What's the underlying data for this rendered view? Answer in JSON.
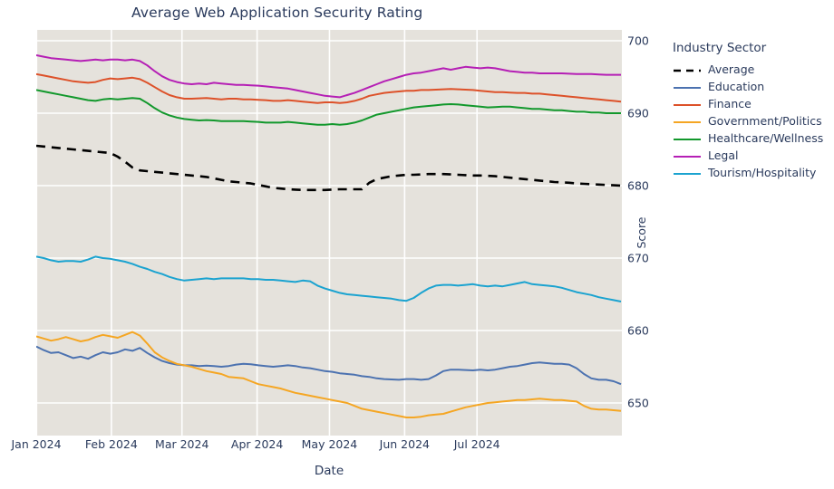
{
  "chart_data": {
    "type": "line",
    "title": "Average Web Application Security Rating",
    "xlabel": "Date",
    "ylabel": "Score",
    "grid": true,
    "legend_position": "right",
    "legend_title": "Industry Sector",
    "yaxis_side": "right",
    "ylim": [
      645.5,
      701.5
    ],
    "yticks": [
      650,
      660,
      670,
      680,
      690,
      700
    ],
    "ytick_labels": [
      "650",
      "660",
      "670",
      "680",
      "690",
      "700"
    ],
    "xlim": [
      "2024-01-01",
      "2024-07-20"
    ],
    "xticks": [
      "2024-01-01",
      "2024-02-01",
      "2024-03-01",
      "2024-04-01",
      "2024-05-01",
      "2024-06-01",
      "2024-07-01"
    ],
    "xtick_labels": [
      "Jan 2024",
      "Feb 2024",
      "Mar 2024",
      "Apr 2024",
      "May 2024",
      "Jun 2024",
      "Jul 2024"
    ],
    "x": [
      0,
      1,
      2,
      3,
      4,
      5,
      6,
      7,
      8,
      9,
      10,
      11,
      12,
      13,
      14,
      15,
      16,
      17,
      18,
      19,
      20,
      21,
      22,
      23,
      24,
      25,
      26,
      27,
      28,
      29,
      30,
      31,
      32,
      33,
      34,
      35,
      36,
      37,
      38,
      39,
      40,
      41,
      42,
      43,
      44,
      45,
      46,
      47,
      48,
      49,
      50,
      51,
      52,
      53,
      54,
      55,
      56,
      57,
      58,
      59,
      60,
      61,
      62,
      63,
      64,
      65,
      66,
      67,
      68,
      69,
      70,
      71,
      72,
      73,
      74,
      75,
      76,
      77,
      78,
      79
    ],
    "series": [
      {
        "name": "Average",
        "color": "#000000",
        "style": "dashed",
        "values": [
          685.5,
          685.4,
          685.3,
          685.2,
          685.1,
          685.0,
          684.9,
          684.8,
          684.7,
          684.6,
          684.5,
          684.0,
          683.3,
          682.5,
          682.1,
          682.0,
          681.9,
          681.8,
          681.7,
          681.6,
          681.5,
          681.4,
          681.3,
          681.2,
          681.0,
          680.8,
          680.6,
          680.5,
          680.4,
          680.3,
          680.1,
          679.9,
          679.7,
          679.6,
          679.5,
          679.45,
          679.4,
          679.4,
          679.4,
          679.4,
          679.45,
          679.5,
          679.5,
          679.5,
          679.5,
          680.4,
          680.9,
          681.1,
          681.3,
          681.4,
          681.5,
          681.5,
          681.55,
          681.6,
          681.6,
          681.6,
          681.55,
          681.5,
          681.45,
          681.4,
          681.4,
          681.35,
          681.3,
          681.2,
          681.1,
          681.0,
          680.9,
          680.8,
          680.7,
          680.6,
          680.5,
          680.45,
          680.4,
          680.3,
          680.25,
          680.2,
          680.15,
          680.1,
          680.05,
          680.0
        ]
      },
      {
        "name": "Education",
        "color": "#4c72b0",
        "style": "solid",
        "values": [
          657.8,
          657.3,
          656.9,
          657.0,
          656.6,
          656.2,
          656.4,
          656.1,
          656.6,
          657.0,
          656.8,
          657.0,
          657.4,
          657.2,
          657.6,
          656.9,
          656.3,
          655.8,
          655.5,
          655.3,
          655.2,
          655.2,
          655.1,
          655.15,
          655.1,
          655.0,
          655.1,
          655.3,
          655.4,
          655.35,
          655.2,
          655.1,
          655.0,
          655.1,
          655.2,
          655.1,
          654.9,
          654.8,
          654.6,
          654.4,
          654.3,
          654.1,
          654.0,
          653.9,
          653.7,
          653.6,
          653.4,
          653.3,
          653.25,
          653.2,
          653.3,
          653.3,
          653.2,
          653.3,
          653.8,
          654.4,
          654.6,
          654.6,
          654.55,
          654.5,
          654.6,
          654.5,
          654.6,
          654.8,
          655.0,
          655.1,
          655.3,
          655.5,
          655.6,
          655.5,
          655.4,
          655.4,
          655.3,
          654.8,
          654.0,
          653.4,
          653.2,
          653.2,
          653.0,
          652.6
        ]
      },
      {
        "name": "Finance",
        "color": "#dd5129",
        "style": "solid",
        "values": [
          695.4,
          695.2,
          695.0,
          694.8,
          694.6,
          694.4,
          694.3,
          694.2,
          694.3,
          694.6,
          694.8,
          694.7,
          694.8,
          694.9,
          694.7,
          694.2,
          693.6,
          693.0,
          692.5,
          692.2,
          692.0,
          692.0,
          692.05,
          692.1,
          692.0,
          691.9,
          692.0,
          692.0,
          691.9,
          691.9,
          691.85,
          691.8,
          691.7,
          691.7,
          691.8,
          691.7,
          691.6,
          691.5,
          691.4,
          691.5,
          691.5,
          691.4,
          691.5,
          691.7,
          692.0,
          692.4,
          692.6,
          692.8,
          692.9,
          693.0,
          693.1,
          693.1,
          693.2,
          693.2,
          693.25,
          693.3,
          693.35,
          693.3,
          693.25,
          693.2,
          693.1,
          693.0,
          692.9,
          692.9,
          692.85,
          692.8,
          692.8,
          692.7,
          692.7,
          692.6,
          692.5,
          692.4,
          692.3,
          692.2,
          692.1,
          692.0,
          691.9,
          691.8,
          691.7,
          691.6
        ]
      },
      {
        "name": "Government/Politics",
        "color": "#f5a623",
        "style": "solid",
        "values": [
          659.2,
          658.9,
          658.6,
          658.8,
          659.1,
          658.8,
          658.5,
          658.7,
          659.1,
          659.4,
          659.2,
          659.0,
          659.4,
          659.8,
          659.3,
          658.2,
          657.0,
          656.3,
          655.8,
          655.4,
          655.2,
          655.0,
          654.7,
          654.4,
          654.2,
          654.0,
          653.6,
          653.5,
          653.4,
          653.0,
          652.6,
          652.4,
          652.2,
          652.0,
          651.7,
          651.4,
          651.2,
          651.0,
          650.8,
          650.6,
          650.4,
          650.2,
          650.0,
          649.6,
          649.2,
          649.0,
          648.8,
          648.6,
          648.4,
          648.2,
          648.0,
          648.0,
          648.1,
          648.3,
          648.4,
          648.5,
          648.8,
          649.1,
          649.4,
          649.6,
          649.8,
          650.0,
          650.1,
          650.2,
          650.3,
          650.4,
          650.4,
          650.5,
          650.6,
          650.5,
          650.4,
          650.4,
          650.3,
          650.2,
          649.6,
          649.2,
          649.1,
          649.1,
          649.0,
          648.9
        ]
      },
      {
        "name": "Healthcare/Wellness",
        "color": "#12982c",
        "style": "solid",
        "values": [
          693.2,
          693.0,
          692.8,
          692.6,
          692.4,
          692.2,
          692.0,
          691.8,
          691.7,
          691.9,
          692.0,
          691.9,
          692.0,
          692.1,
          692.0,
          691.4,
          690.7,
          690.1,
          689.7,
          689.4,
          689.2,
          689.1,
          689.0,
          689.05,
          689.0,
          688.9,
          688.9,
          688.9,
          688.9,
          688.85,
          688.8,
          688.7,
          688.7,
          688.7,
          688.8,
          688.7,
          688.6,
          688.5,
          688.4,
          688.4,
          688.5,
          688.4,
          688.5,
          688.7,
          689.0,
          689.4,
          689.8,
          690.0,
          690.2,
          690.4,
          690.6,
          690.8,
          690.9,
          691.0,
          691.1,
          691.2,
          691.25,
          691.2,
          691.1,
          691.0,
          690.9,
          690.8,
          690.85,
          690.9,
          690.9,
          690.8,
          690.7,
          690.6,
          690.6,
          690.5,
          690.4,
          690.4,
          690.3,
          690.2,
          690.2,
          690.1,
          690.1,
          690.0,
          690.0,
          690.0
        ]
      },
      {
        "name": "Legal",
        "color": "#b51fb5",
        "style": "solid",
        "values": [
          698.0,
          697.8,
          697.6,
          697.5,
          697.4,
          697.3,
          697.2,
          697.3,
          697.4,
          697.3,
          697.4,
          697.4,
          697.3,
          697.4,
          697.2,
          696.6,
          695.8,
          695.1,
          694.6,
          694.3,
          694.1,
          694.0,
          694.1,
          694.0,
          694.2,
          694.1,
          694.0,
          693.9,
          693.9,
          693.85,
          693.8,
          693.7,
          693.6,
          693.5,
          693.4,
          693.2,
          693.0,
          692.8,
          692.6,
          692.4,
          692.3,
          692.2,
          692.5,
          692.8,
          693.2,
          693.6,
          694.0,
          694.4,
          694.7,
          695.0,
          695.3,
          695.5,
          695.6,
          695.8,
          696.0,
          696.2,
          696.0,
          696.2,
          696.4,
          696.3,
          696.2,
          696.3,
          696.2,
          696.0,
          695.8,
          695.7,
          695.6,
          695.6,
          695.5,
          695.5,
          695.5,
          695.5,
          695.45,
          695.4,
          695.4,
          695.4,
          695.35,
          695.3,
          695.3,
          695.3
        ]
      },
      {
        "name": "Tourism/Hospitality",
        "color": "#1ba3d0",
        "style": "solid",
        "values": [
          670.2,
          670.0,
          669.7,
          669.5,
          669.6,
          669.6,
          669.5,
          669.8,
          670.2,
          670.0,
          669.9,
          669.7,
          669.5,
          669.2,
          668.8,
          668.5,
          668.1,
          667.8,
          667.4,
          667.1,
          666.9,
          667.0,
          667.1,
          667.2,
          667.1,
          667.2,
          667.2,
          667.2,
          667.2,
          667.1,
          667.1,
          667.0,
          667.0,
          666.9,
          666.8,
          666.7,
          666.9,
          666.8,
          666.2,
          665.8,
          665.5,
          665.2,
          665.0,
          664.9,
          664.8,
          664.7,
          664.6,
          664.5,
          664.4,
          664.2,
          664.1,
          664.5,
          665.2,
          665.8,
          666.2,
          666.3,
          666.3,
          666.2,
          666.3,
          666.4,
          666.2,
          666.1,
          666.2,
          666.1,
          666.3,
          666.5,
          666.7,
          666.4,
          666.3,
          666.2,
          666.1,
          665.9,
          665.6,
          665.3,
          665.1,
          664.9,
          664.6,
          664.4,
          664.2,
          664.0
        ]
      }
    ]
  },
  "legend": {
    "title": "Industry Sector",
    "items": [
      {
        "label": "Average",
        "color": "#000000",
        "style": "dashed"
      },
      {
        "label": "Education",
        "color": "#4c72b0",
        "style": "solid"
      },
      {
        "label": "Finance",
        "color": "#dd5129",
        "style": "solid"
      },
      {
        "label": "Government/Politics",
        "color": "#f5a623",
        "style": "solid"
      },
      {
        "label": "Healthcare/Wellness",
        "color": "#12982c",
        "style": "solid"
      },
      {
        "label": "Legal",
        "color": "#b51fb5",
        "style": "solid"
      },
      {
        "label": "Tourism/Hospitality",
        "color": "#1ba3d0",
        "style": "solid"
      }
    ]
  },
  "theme": {
    "plot_background": "#e5e2dc",
    "figure_background": "#ffffff",
    "grid_color": "#ffffff",
    "text_color": "#2a3a5c"
  }
}
